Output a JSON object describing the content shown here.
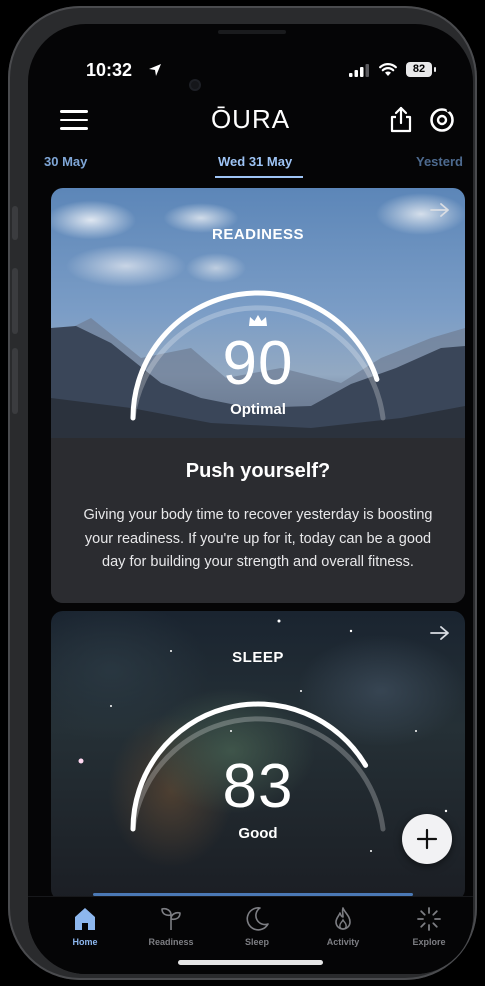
{
  "status_bar": {
    "time": "10:32",
    "battery": "82"
  },
  "header": {
    "logo": "ŌURA"
  },
  "date_tabs": {
    "previous": "30 May",
    "current": "Wed 31 May",
    "next": "Yesterd"
  },
  "readiness_card": {
    "title": "READINESS",
    "score": "90",
    "score_fraction": 0.9,
    "label": "Optimal",
    "headline": "Push yourself?",
    "description": "Giving your body time to recover yesterday is boosting your readiness. If you're up for it, today can be a good day for building your strength and overall fitness."
  },
  "sleep_card": {
    "title": "SLEEP",
    "score": "83",
    "score_fraction": 0.83,
    "label": "Good"
  },
  "tab_bar": {
    "items": [
      {
        "label": "Home",
        "icon": "home-icon",
        "active": true
      },
      {
        "label": "Readiness",
        "icon": "readiness-icon",
        "active": false
      },
      {
        "label": "Sleep",
        "icon": "moon-icon",
        "active": false
      },
      {
        "label": "Activity",
        "icon": "flame-icon",
        "active": false
      },
      {
        "label": "Explore",
        "icon": "sparkle-icon",
        "active": false
      }
    ]
  },
  "colors": {
    "accent": "#8db7ee",
    "date_active": "#9ec4f5",
    "background": "#050506"
  }
}
